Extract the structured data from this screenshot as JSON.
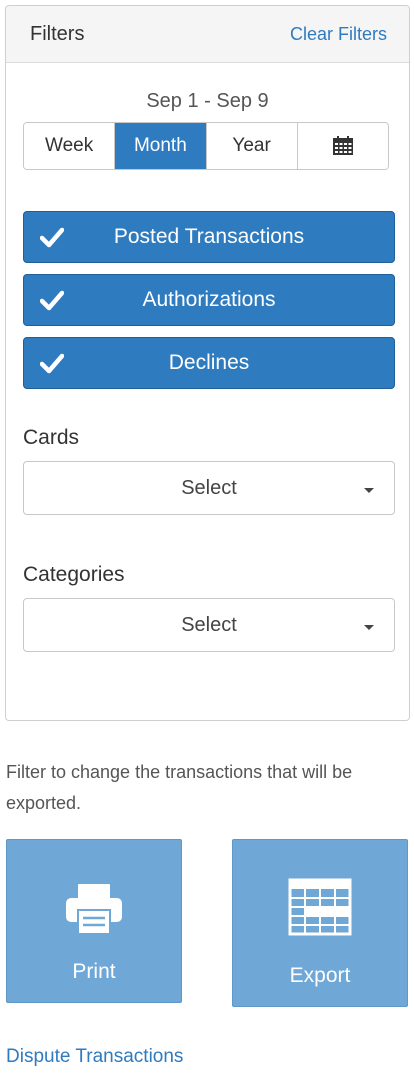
{
  "filters": {
    "title": "Filters",
    "clear_label": "Clear Filters",
    "date_range": "Sep 1 - Sep 9",
    "period_options": [
      {
        "label": "Week",
        "active": false
      },
      {
        "label": "Month",
        "active": true
      },
      {
        "label": "Year",
        "active": false
      }
    ],
    "calendar_icon": "calendar-icon",
    "toggles": [
      {
        "label": "Posted Transactions",
        "checked": true
      },
      {
        "label": "Authorizations",
        "checked": true
      },
      {
        "label": "Declines",
        "checked": true
      }
    ],
    "cards": {
      "label": "Cards",
      "value": "Select"
    },
    "categories": {
      "label": "Categories",
      "value": "Select"
    }
  },
  "export_hint": "Filter to change the transactions that will be exported.",
  "actions": {
    "print": {
      "label": "Print",
      "icon": "printer-icon"
    },
    "export": {
      "label": "Export",
      "icon": "spreadsheet-icon"
    }
  },
  "dispute_label": "Dispute Transactions",
  "colors": {
    "primary": "#2f7bbf",
    "action_button": "#6fa7d6",
    "panel_header": "#f5f5f5"
  }
}
